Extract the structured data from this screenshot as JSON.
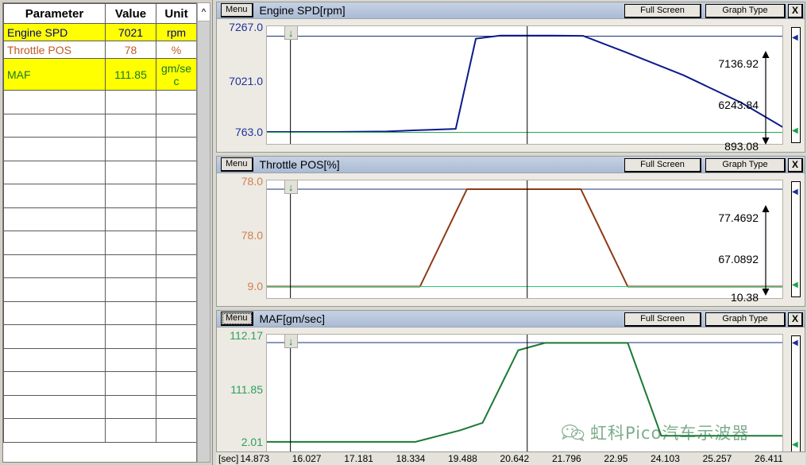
{
  "param_table": {
    "columns": [
      "Parameter",
      "Value",
      "Unit"
    ],
    "scroll_up_icon": "^",
    "rows": [
      {
        "name": "Engine SPD",
        "value": "7021",
        "unit": "rpm",
        "highlight": true,
        "color": "blue"
      },
      {
        "name": "Throttle POS",
        "value": "78",
        "unit": "%",
        "highlight": false,
        "color": "orange"
      },
      {
        "name": "MAF",
        "value": "111.85",
        "unit": "gm/sec",
        "highlight": true,
        "color": "green"
      }
    ],
    "empty_row_count": 15
  },
  "graphs": [
    {
      "menu_label": "Menu",
      "menu_focused": false,
      "title": "Engine SPD[rpm]",
      "full_screen_label": "Full Screen",
      "graph_type_label": "Graph Type",
      "close_label": "X",
      "axis_color": "#2030a0",
      "trace_color": "#0d1a8c",
      "y_ticks": [
        "7267.0",
        "7021.0",
        "763.0"
      ],
      "readouts": [
        "7136.92",
        "6243.84",
        "893.08"
      ],
      "cursor_icon": "↓"
    },
    {
      "menu_label": "Menu",
      "menu_focused": false,
      "title": "Throttle POS[%]",
      "full_screen_label": "Full Screen",
      "graph_type_label": "Graph Type",
      "close_label": "X",
      "axis_color": "#d08050",
      "trace_color": "#8c3a14",
      "y_ticks": [
        "78.0",
        "78.0",
        "9.0"
      ],
      "readouts": [
        "77.4692",
        "67.0892",
        "10.38"
      ],
      "cursor_icon": "↓"
    },
    {
      "menu_label": "Menu",
      "menu_focused": true,
      "title": "MAF[gm/sec]",
      "full_screen_label": "Full Screen",
      "graph_type_label": "Graph Type",
      "close_label": "X",
      "axis_color": "#2e9e62",
      "trace_color": "#1a7a34",
      "y_ticks": [
        "112.17",
        "111.85",
        "2.01"
      ],
      "readouts": [
        "",
        "",
        ""
      ],
      "cursor_icon": "↓"
    }
  ],
  "x_axis": {
    "unit_label": "[sec]",
    "ticks": [
      "14.873",
      "16.027",
      "17.181",
      "18.334",
      "19.488",
      "20.642",
      "21.796",
      "22.95",
      "24.103",
      "25.257",
      "26.411"
    ]
  },
  "watermark": {
    "text": "虹科Pico汽车示波器",
    "color": "#2e7a47"
  },
  "chart_data": [
    {
      "type": "line",
      "title": "Engine SPD[rpm]",
      "ylabel": "rpm",
      "xlabel": "[sec]",
      "ylim": [
        763.0,
        7267.0
      ],
      "xlim": [
        14.873,
        26.411
      ],
      "grid": false,
      "cursor_x": 15.4,
      "marker_x": 20.7,
      "series": [
        {
          "name": "Engine SPD",
          "color": "#0d1a8c",
          "x": [
            14.873,
            16.4,
            17.55,
            18.15,
            18.55,
            19.1,
            19.55,
            20.1,
            20.7,
            21.25,
            21.95,
            22.9,
            24.2,
            25.5,
            26.411
          ],
          "y": [
            920,
            920,
            950,
            1020,
            1060,
            1120,
            6980,
            7180,
            7180,
            7180,
            7160,
            6100,
            4600,
            2800,
            1250
          ]
        },
        {
          "name": "threshold",
          "color": "#22aa55",
          "x": [
            14.873,
            26.411
          ],
          "y": [
            893.08,
            893.08
          ]
        }
      ],
      "readout_high": 7136.92,
      "readout_mid": 6243.84,
      "readout_low": 893.08
    },
    {
      "type": "line",
      "title": "Throttle POS[%]",
      "ylabel": "%",
      "xlabel": "[sec]",
      "ylim": [
        9.0,
        78.0
      ],
      "xlim": [
        14.873,
        26.411
      ],
      "grid": false,
      "cursor_x": 15.4,
      "marker_x": 20.7,
      "series": [
        {
          "name": "Throttle POS",
          "color": "#8c3a14",
          "x": [
            14.873,
            18.3,
            19.35,
            20.7,
            21.9,
            22.95,
            26.411
          ],
          "y": [
            10.38,
            10.38,
            77.47,
            77.47,
            77.47,
            10.38,
            10.38
          ]
        },
        {
          "name": "threshold",
          "color": "#22cc77",
          "x": [
            14.873,
            26.411
          ],
          "y": [
            10.38,
            10.38
          ]
        }
      ],
      "readout_high": 77.4692,
      "readout_mid": 67.0892,
      "readout_low": 10.38
    },
    {
      "type": "line",
      "title": "MAF[gm/sec]",
      "ylabel": "gm/sec",
      "xlabel": "[sec]",
      "ylim": [
        2.01,
        112.17
      ],
      "xlim": [
        14.873,
        26.411
      ],
      "grid": false,
      "cursor_x": 15.4,
      "marker_x": 20.7,
      "series": [
        {
          "name": "MAF",
          "color": "#1a7a34",
          "x": [
            14.873,
            18.2,
            19.2,
            19.7,
            20.5,
            21.1,
            22.0,
            22.95,
            23.7,
            26.411
          ],
          "y": [
            5.5,
            5.5,
            18.0,
            26.0,
            104.0,
            111.85,
            111.85,
            111.85,
            12.0,
            12.0
          ]
        }
      ],
      "readout_high": 112.17,
      "readout_mid": 111.85,
      "readout_low": 2.01
    }
  ]
}
